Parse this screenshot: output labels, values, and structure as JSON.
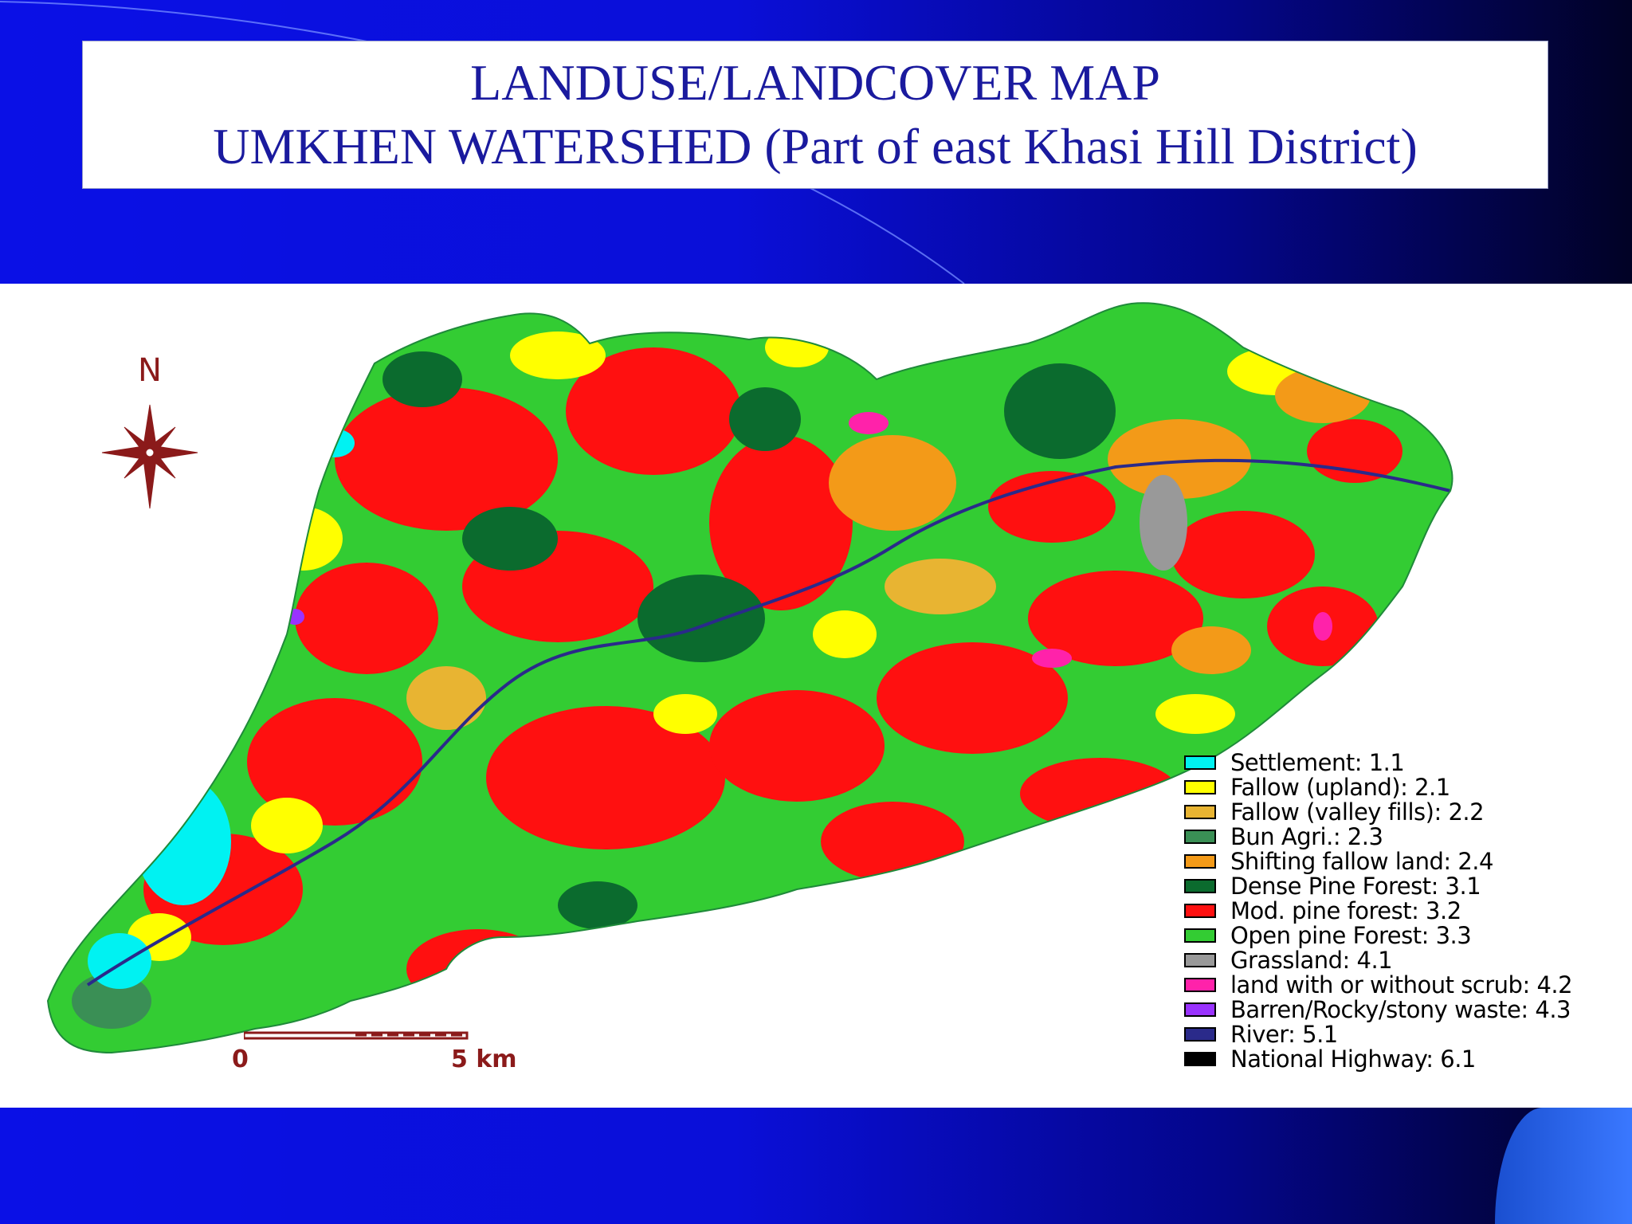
{
  "title": {
    "line1": "LANDUSE/LANDCOVER MAP",
    "line2": "UMKHEN WATERSHED (Part of east Khasi Hill District)"
  },
  "north_arrow": {
    "label": "N",
    "icon": "compass-rose-icon"
  },
  "scale_bar": {
    "start_label": "0",
    "end_label": "5 km"
  },
  "legend": {
    "items": [
      {
        "label": "Settlement: 1.1",
        "color": "#00f2f2"
      },
      {
        "label": "Fallow (upland): 2.1",
        "color": "#ffff00"
      },
      {
        "label": "Fallow (valley fills): 2.2",
        "color": "#e8b432"
      },
      {
        "label": "Bun Agri.: 2.3",
        "color": "#3a8f55"
      },
      {
        "label": "Shifting fallow land: 2.4",
        "color": "#f39a18"
      },
      {
        "label": "Dense Pine Forest: 3.1",
        "color": "#0b6b2e"
      },
      {
        "label": "Mod. pine forest: 3.2",
        "color": "#ff1010"
      },
      {
        "label": "Open pine Forest: 3.3",
        "color": "#33cc33"
      },
      {
        "label": "Grassland: 4.1",
        "color": "#999999"
      },
      {
        "label": "land with or without scrub: 4.2",
        "color": "#ff22aa"
      },
      {
        "label": "Barren/Rocky/stony waste: 4.3",
        "color": "#9a33ff"
      },
      {
        "label": "River: 5.1",
        "color": "#2a2a8a"
      },
      {
        "label": "National Highway: 6.1",
        "color": "#000000"
      }
    ]
  }
}
